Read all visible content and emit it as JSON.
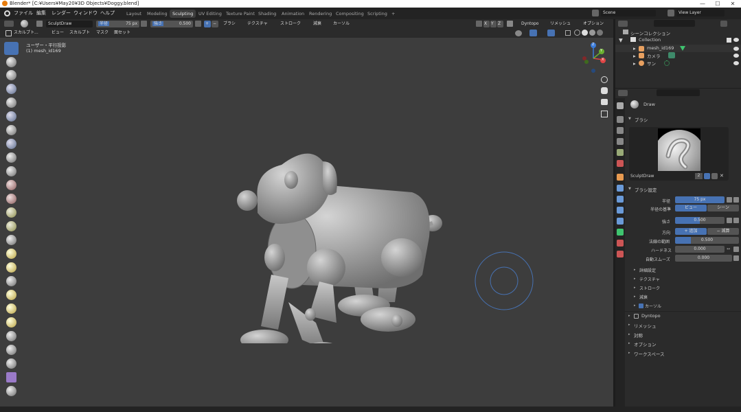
{
  "window": {
    "title": "Blender* [C:¥Users¥May20¥3D Objects¥Doggy.blend]",
    "controls": [
      "—",
      "☐",
      "✕"
    ]
  },
  "menu": {
    "items": [
      "ファイル",
      "編集",
      "レンダー",
      "ウィンドウ",
      "ヘルプ"
    ]
  },
  "workspaces": [
    "Layout",
    "Modeling",
    "Sculpting",
    "UV Editing",
    "Texture Paint",
    "Shading",
    "Animation",
    "Rendering",
    "Compositing",
    "Scripting",
    "+"
  ],
  "scene": {
    "name": "Scene",
    "view_layer": "View Layer"
  },
  "tool_header": {
    "brush_name": "SculptDraw",
    "radius_label": "半径",
    "radius_value": "75 px",
    "strength_label": "強さ",
    "strength_value": "0.500",
    "plus": "+",
    "minus": "−",
    "brush_menu": "ブラシ",
    "texture_menu": "テクスチャ",
    "stroke_menu": "ストローク",
    "falloff_menu": "減衰",
    "cursor_menu": "カーソル",
    "axes": [
      "X",
      "Y",
      "Z"
    ],
    "dyntopo": "Dyntopo",
    "remesh": "リメッシュ",
    "options": "オプション"
  },
  "header2": {
    "mode": "スカルプト...",
    "view": "ビュー",
    "sculpt": "スカルプト",
    "mask": "マスク",
    "face_sets": "面セット"
  },
  "viewport": {
    "view_name": "ユーザー・平行投影",
    "object_name": "(1) mesh_id169",
    "gizmo": {
      "x": "X",
      "y": "Y",
      "z": "Z"
    }
  },
  "outliner": {
    "root": "シーンコレクション",
    "collection": "Collection",
    "objects": [
      {
        "name": "mesh_id169",
        "icon": "mesh-icon"
      },
      {
        "name": "カメラ",
        "icon": "camera-icon"
      },
      {
        "name": "サン",
        "icon": "sun-icon"
      }
    ]
  },
  "properties": {
    "tool_name": "Draw",
    "brush_section": "ブラシ",
    "brush_name": "SculptDraw",
    "brush_users": "2",
    "brush_settings": "ブラシ設定",
    "radius_label": "半径",
    "radius_value": "75 px",
    "radius_unit_label": "半径の基準",
    "radius_unit_view": "ビュー",
    "radius_unit_scene": "シーン",
    "strength_label": "強さ",
    "strength_value": "0.500",
    "direction_label": "方向",
    "direction_add": "追加",
    "direction_sub": "減算",
    "plus": "+",
    "minus": "−",
    "normal_radius_label": "法線の範囲",
    "normal_radius_value": "0.500",
    "hardness_label": "ハードネス",
    "hardness_value": "0.000",
    "autosmooth_label": "自動スムーズ",
    "autosmooth_value": "0.000",
    "subsections": [
      "詳細設定",
      "テクスチャ",
      "ストローク",
      "減衰",
      "カーソル"
    ],
    "panels": [
      "Dyntopo",
      "リメッシュ",
      "対称",
      "オプション",
      "ワークスペース"
    ]
  },
  "colors": {
    "accent": "#4772b3",
    "viewport_bg": "#3d3d3d",
    "panel_bg": "#2b2b2b",
    "field_bg": "#545454"
  }
}
